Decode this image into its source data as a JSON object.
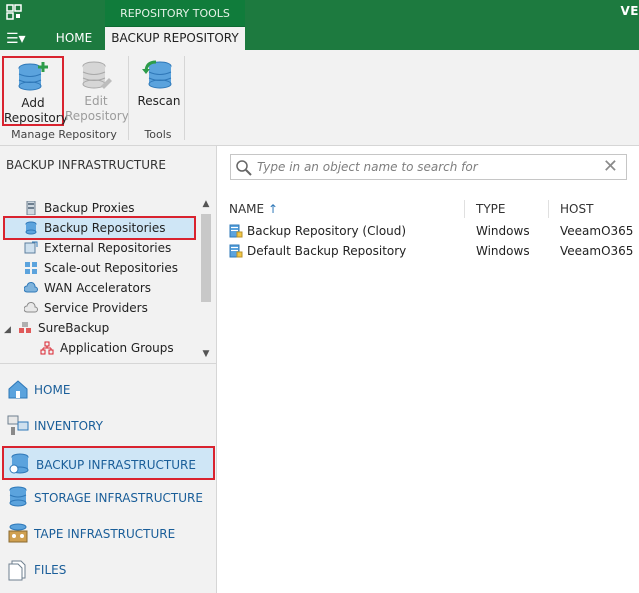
{
  "titlebar": {
    "context_group": "REPOSITORY TOOLS",
    "app_title_partial": "VE"
  },
  "ribbon_tabs": {
    "menu_symbol": "☰▾",
    "home": "HOME",
    "backup_repository": "BACKUP REPOSITORY"
  },
  "ribbon": {
    "add_line1": "Add",
    "add_line2": "Repository",
    "edit_line1": "Edit",
    "edit_line2": "Repository",
    "rescan": "Rescan",
    "group_manage": "Manage Repository",
    "group_tools": "Tools"
  },
  "sidebar": {
    "header": "BACKUP INFRASTRUCTURE",
    "tree": [
      {
        "label": "Backup Proxies"
      },
      {
        "label": "Backup Repositories"
      },
      {
        "label": "External Repositories"
      },
      {
        "label": "Scale-out Repositories"
      },
      {
        "label": "WAN Accelerators"
      },
      {
        "label": "Service Providers"
      },
      {
        "label": "SureBackup"
      },
      {
        "label": "Application Groups"
      }
    ],
    "nav": [
      {
        "label": "HOME"
      },
      {
        "label": "INVENTORY"
      },
      {
        "label": "BACKUP INFRASTRUCTURE"
      },
      {
        "label": "STORAGE INFRASTRUCTURE"
      },
      {
        "label": "TAPE INFRASTRUCTURE"
      },
      {
        "label": "FILES"
      }
    ]
  },
  "search": {
    "placeholder": "Type in an object name to search for"
  },
  "table": {
    "columns": {
      "name": "NAME",
      "type": "TYPE",
      "host": "HOST"
    },
    "sort_arrow": "↑",
    "rows": [
      {
        "name": "Backup Repository (Cloud)",
        "type": "Windows",
        "host": "VeeamO365"
      },
      {
        "name": "Default Backup Repository",
        "type": "Windows",
        "host": "VeeamO365"
      }
    ]
  },
  "colors": {
    "brand_green": "#1d7a3f",
    "highlight_red": "#d9232f",
    "selection_blue": "#cfe6f6",
    "nav_text": "#1a5e99"
  }
}
